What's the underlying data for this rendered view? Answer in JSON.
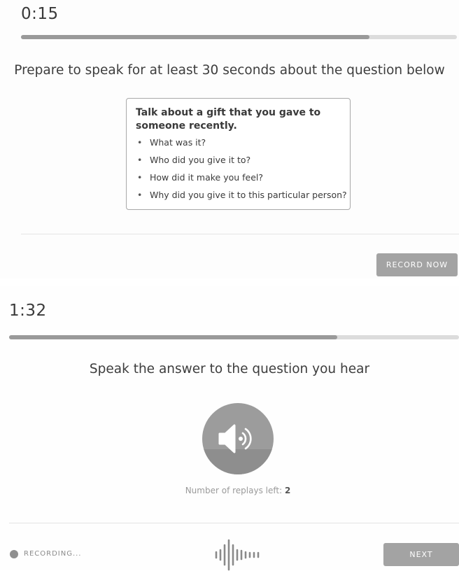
{
  "prepare": {
    "timer": "0:15",
    "progress": 0.8,
    "instruction": "Prepare to speak for at least 30 seconds about the question below",
    "question_title": "Talk about a gift that you gave to someone recently.",
    "bullets": [
      "What was it?",
      "Who did you give it to?",
      "How did it make you feel?",
      "Why did you give it to this particular person?"
    ],
    "record_button": "RECORD NOW"
  },
  "answer": {
    "timer": "1:32",
    "progress": 0.73,
    "instruction": "Speak the answer to the question you hear",
    "speaker_icon": "speaker-icon",
    "replays_label": "Number of replays left:",
    "replays_count": "2",
    "recording_label": "RECORDING...",
    "waveform_icon": "waveform-icon",
    "next_button": "NEXT"
  },
  "colors": {
    "progress_fill": "#9a9a9a",
    "progress_track": "#dcdcdc",
    "button_bg": "#a3a3a3",
    "speaker_bg": "#9c9c9c"
  }
}
